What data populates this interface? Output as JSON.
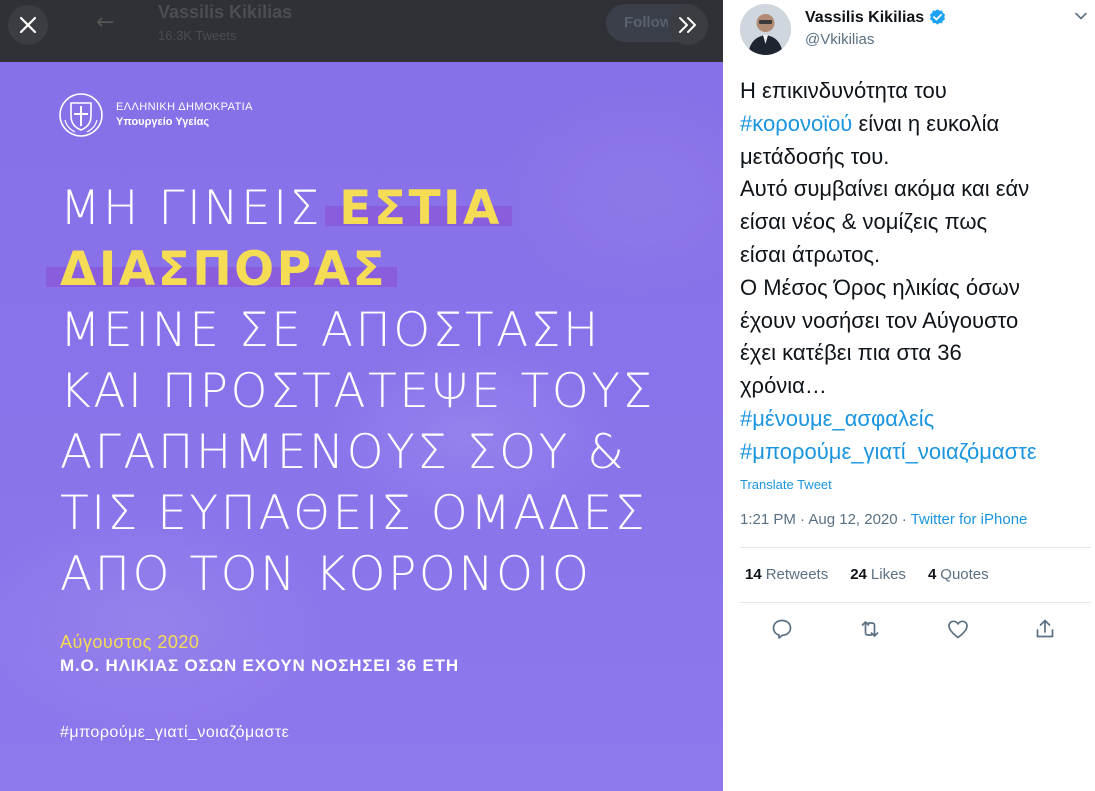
{
  "background_profile": {
    "name": "Vassilis Kikilias",
    "tweets_count": "16.3K Tweets",
    "follow_label": "Follow"
  },
  "poster": {
    "org_line1": "ΕΛΛΗΝΙΚΗ ΔΗΜΟΚΡΑΤΙΑ",
    "org_line2": "Υπουργείο Υγείας",
    "headline": {
      "line1_plain": "ΜΗ ΓΙΝΕΙΣ ",
      "line1_highlight": "ΕΣΤΙΑ",
      "line2_highlight": "ΔΙΑΣΠΟΡΑΣ",
      "line3": "ΜΕΙΝΕ ΣΕ ΑΠΟΣΤΑΣΗ",
      "line4": "ΚΑΙ ΠΡΟΣΤΑΤΕΨΕ ΤΟΥΣ",
      "line5": "ΑΓΑΠΗΜΕΝΟΥΣ ΣΟΥ &",
      "line6": "ΤΙΣ ΕΥΠΑΘΕΙΣ ΟΜΑΔΕΣ",
      "line7": "ΑΠΟ ΤΟΝ ΚΟΡΟΝΟΙΟ"
    },
    "date": "Αύγουστος 2020",
    "average_age": "Μ.Ο. ΗΛΙΚΙΑΣ ΟΣΩΝ ΕΧΟΥΝ ΝΟΣΗΣΕΙ 36 ΕΤΗ",
    "hashtag": "#μπορούμε_γιατί_νοιαζόμαστε"
  },
  "tweet": {
    "author_name": "Vassilis Kikilias",
    "handle": "@Vkikilias",
    "text_lines": [
      "Η επικινδυνότητα του",
      "#κορονοϊού",
      " είναι η ευκολία",
      "μετάδοσής του.",
      "Αυτό συμβαίνει ακόμα και εάν",
      "είσαι νέος & νομίζεις πως",
      "είσαι άτρωτος.",
      "Ο Μέσος Όρος ηλικίας όσων",
      "έχουν νοσήσει τον Αύγουστο",
      "έχει κατέβει πια στα 36",
      "χρόνια…",
      "#μένουμε_ασφαλείς",
      "#μπορούμε_γιατί_νοιαζόμαστε"
    ],
    "translate_label": "Translate Tweet",
    "timestamp": "1:21 PM · Aug 12, 2020 · ",
    "source": "Twitter for iPhone",
    "stats": {
      "retweets_count": "14",
      "retweets_label": "Retweets",
      "likes_count": "24",
      "likes_label": "Likes",
      "quotes_count": "4",
      "quotes_label": "Quotes"
    }
  },
  "icons": {
    "close": "close-icon",
    "expand": "double-chevron-right-icon",
    "verified": "verified-badge-icon",
    "more": "chevron-down-icon",
    "reply": "reply-icon",
    "retweet": "retweet-icon",
    "like": "heart-icon",
    "share": "share-icon"
  },
  "colors": {
    "poster_purple": "#8a73ea",
    "poster_yellow": "#f5dc55",
    "twitter_blue": "#1b95e0",
    "verified_blue": "#1da1f2"
  }
}
